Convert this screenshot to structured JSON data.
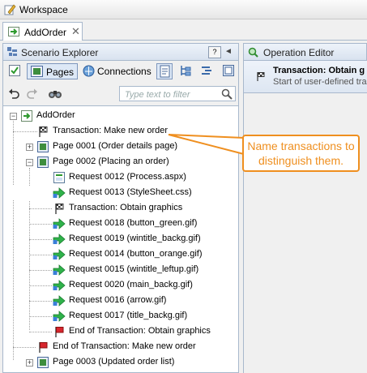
{
  "window": {
    "title": "Workspace"
  },
  "document_tab": {
    "label": "AddOrder",
    "close": "✕"
  },
  "scenario_explorer": {
    "title": "Scenario Explorer",
    "help": "?",
    "pin": "◄",
    "toolbar": {
      "pages_label": "Pages",
      "connections_label": "Connections"
    },
    "filter": {
      "placeholder": "Type text to filter"
    }
  },
  "tree": {
    "root": "AddOrder",
    "items": [
      {
        "label": "Transaction: Make new order",
        "icon": "flag-icon"
      },
      {
        "label": "Page 0001 (Order details page)",
        "icon": "page-icon"
      },
      {
        "label": "Page 0002 (Placing an order)",
        "icon": "page-icon"
      },
      {
        "label": "Request 0012 (Process.aspx)",
        "icon": "request-page-icon"
      },
      {
        "label": "Request 0013 (StyleSheet.css)",
        "icon": "request-arrow-icon"
      },
      {
        "label": "Transaction: Obtain graphics",
        "icon": "flag-icon"
      },
      {
        "label": "Request 0018 (button_green.gif)",
        "icon": "request-arrow-icon"
      },
      {
        "label": "Request 0019 (wintitle_backg.gif)",
        "icon": "request-arrow-icon"
      },
      {
        "label": "Request 0014 (button_orange.gif)",
        "icon": "request-arrow-icon"
      },
      {
        "label": "Request 0015 (wintitle_leftup.gif)",
        "icon": "request-arrow-icon"
      },
      {
        "label": "Request 0020 (main_backg.gif)",
        "icon": "request-arrow-icon"
      },
      {
        "label": "Request 0016 (arrow.gif)",
        "icon": "request-arrow-icon"
      },
      {
        "label": "Request 0017 (title_backg.gif)",
        "icon": "request-arrow-icon"
      },
      {
        "label": "End of Transaction: Obtain graphics",
        "icon": "end-flag-icon"
      },
      {
        "label": "End of Transaction: Make new order",
        "icon": "end-flag-icon"
      },
      {
        "label": "Page 0003 (Updated order list)",
        "icon": "page-icon"
      }
    ]
  },
  "operation_editor": {
    "title": "Operation Editor",
    "heading": "Transaction: Obtain g",
    "subheading": "Start of user-defined tra"
  },
  "callout": {
    "line1": "Name transactions to",
    "line2": "distinguish them."
  },
  "colors": {
    "accent": "#ef8f1f",
    "panel_border": "#a8b8cc",
    "header_bg": "#d8e2ef"
  }
}
